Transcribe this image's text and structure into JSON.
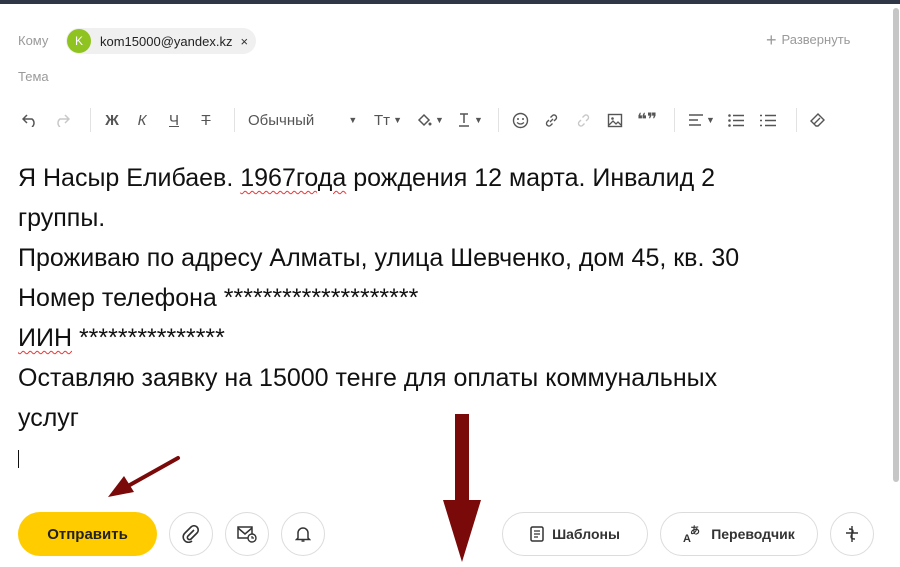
{
  "header": {
    "to_label": "Кому",
    "recipient": {
      "initial": "K",
      "address": "kom15000@yandex.kz",
      "remove": "×"
    },
    "expand_label": "Развернуть",
    "subject_label": "Тема"
  },
  "toolbar": {
    "bold": "Ж",
    "italic": "К",
    "underline": "Ч",
    "strike": "Т",
    "paragraph_style": "Обычный",
    "font_size": "Тт",
    "quote": "❝❞"
  },
  "message": {
    "lines": [
      {
        "pre": "Я Насыр Елибаев. ",
        "sq": "1967года",
        "post": " рождения 12 марта. Инвалид 2"
      },
      {
        "pre": "группы.",
        "sq": "",
        "post": ""
      },
      {
        "pre": "Проживаю по адресу Алматы, улица Шевченко, дом 45, кв. 30",
        "sq": "",
        "post": ""
      },
      {
        "pre": "Номер телефона ********************",
        "sq": "",
        "post": ""
      },
      {
        "pre": "",
        "sq": "ИИН",
        "post": " ***************"
      },
      {
        "pre": "Оставляю заявку на 15000 тенге для оплаты коммунальных",
        "sq": "",
        "post": ""
      },
      {
        "pre": "услуг",
        "sq": "",
        "post": ""
      }
    ]
  },
  "footer": {
    "send_label": "Отправить",
    "templates_label": "Шаблоны",
    "translator_label": "Переводчик"
  },
  "colors": {
    "accent": "#ffcc00",
    "avatar": "#8fc31f",
    "annotation_arrow": "#7a0a0a"
  }
}
